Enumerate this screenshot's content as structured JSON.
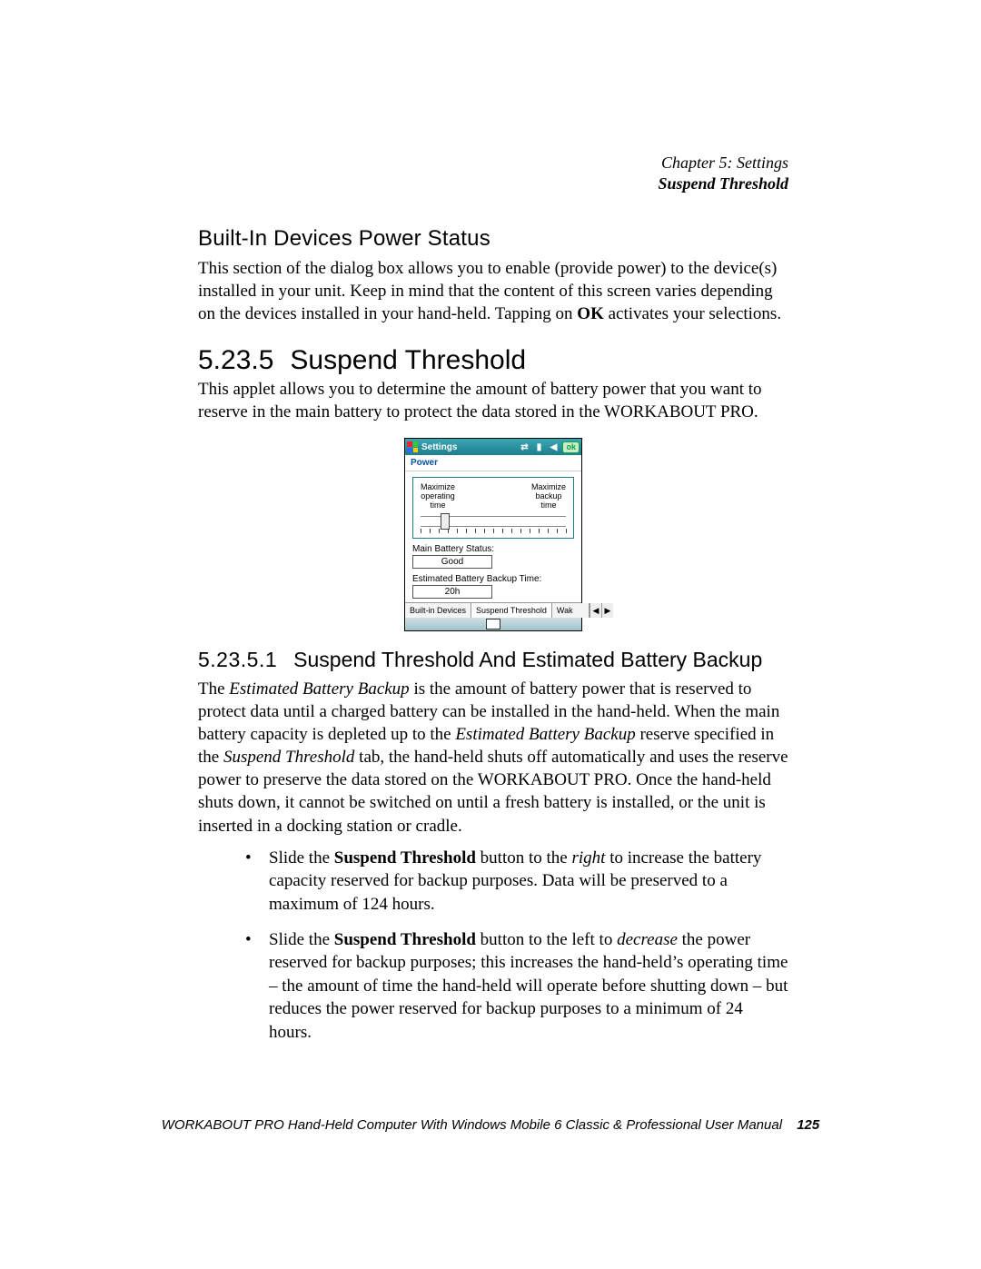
{
  "header": {
    "chapter_line": "Chapter 5: Settings",
    "topic_line": "Suspend Threshold"
  },
  "sections": {
    "builtin_title": "Built-In Devices Power Status",
    "builtin_para_html": "This section of the dialog box allows you to enable (provide power) to the device(s) installed in your unit. Keep in mind that the content of this screen varies depending on the devices installed in your hand-held. Tapping on <strong>OK</strong> activates your selections.",
    "suspend_num": "5.23.5",
    "suspend_title": "Suspend Threshold",
    "suspend_intro": "This applet allows you to determine the amount of battery power that you want to reserve in the main battery to protect the data stored in the WORKABOUT PRO.",
    "sub_num": "5.23.5.1",
    "sub_title": "Suspend Threshold And Estimated Battery Backup",
    "sub_para_html": "The <em>Estimated Battery Backup</em> is the amount of battery power that is reserved to protect data until a charged battery can be installed in the hand-held. When the main battery capacity is depleted up to the <em>Estimated Battery Backup</em> reserve specified in the <em>Suspend Threshold</em> tab, the hand-held shuts off automatically and uses the reserve power to preserve the data stored on the WORKABOUT PRO. Once the hand-held shuts down, it cannot be switched on until a fresh battery is installed, or the unit is inserted in a docking station or cradle.",
    "bullets": [
      "Slide the <strong>Suspend Threshold</strong> button to the <em>right</em> to increase the battery capacity reserved for backup purposes. Data will be preserved to a maximum of 124 hours.",
      "Slide the <strong>Suspend Threshold</strong> button to the left to <em>decrease</em> the power reserved for backup purposes; this increases the hand-held’s operating time – the amount of time the hand-held will operate before shutting down – but reduces the power reserved for backup purposes to a minimum of 24 hours."
    ]
  },
  "screenshot": {
    "window_title": "Settings",
    "ok_label": "ok",
    "tab_title": "Power",
    "left_label": "Maximize\noperating\ntime",
    "right_label": "Maximize\nbackup\ntime",
    "slider_position_pct": 14,
    "tick_count": 17,
    "main_status_label": "Main Battery Status:",
    "main_status_value": "Good",
    "backup_label": "Estimated Battery Backup Time:",
    "backup_value": "20h",
    "tabs": [
      "Built-in Devices",
      "Suspend Threshold",
      "Wak"
    ],
    "active_tab_index": 1
  },
  "footer": {
    "text": "WORKABOUT PRO Hand-Held Computer With Windows Mobile 6 Classic & Professional User Manual",
    "page": "125"
  }
}
